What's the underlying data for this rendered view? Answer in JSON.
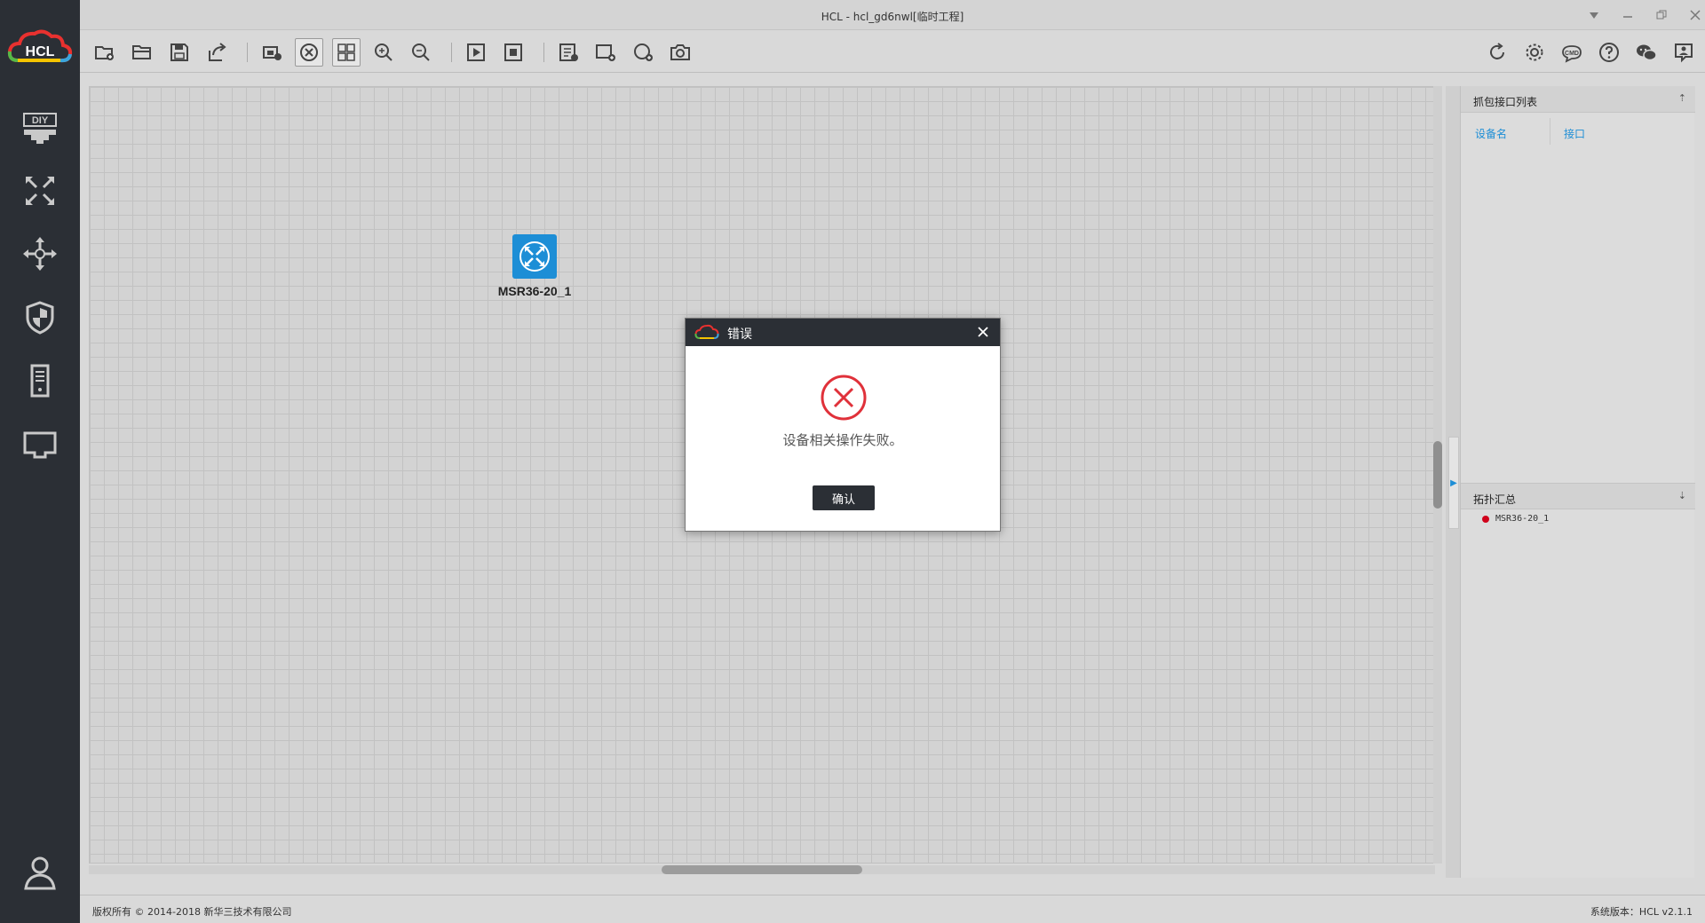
{
  "window": {
    "title": "HCL - hcl_gd6nwl[临时工程]",
    "controls": [
      "dropdown-icon",
      "minimize-icon",
      "restore-icon",
      "close-icon"
    ]
  },
  "sidebar": {
    "logo_text": "HCL",
    "items": [
      {
        "name": "diy",
        "icon": "diy-icon"
      },
      {
        "name": "router",
        "icon": "router-icon"
      },
      {
        "name": "switch",
        "icon": "switch-icon"
      },
      {
        "name": "firewall",
        "icon": "shield-icon"
      },
      {
        "name": "host",
        "icon": "server-icon"
      },
      {
        "name": "cable",
        "icon": "connector-icon"
      }
    ],
    "user_icon": "user-icon"
  },
  "toolbar": {
    "left_tools": [
      "new-project-icon",
      "open-project-icon",
      "save-icon",
      "export-icon",
      "import-device-icon",
      "topology-view-icon",
      "grid-view-icon",
      "zoom-in-icon",
      "zoom-out-icon",
      "start-all-icon",
      "stop-all-icon",
      "list-icon",
      "add-rect-icon",
      "add-ellipse-icon",
      "screenshot-icon"
    ],
    "right_tools": [
      "refresh-icon",
      "settings-icon",
      "cmd-icon",
      "help-icon",
      "wechat-icon",
      "feedback-icon"
    ],
    "cmd_label": "CMD"
  },
  "canvas": {
    "device": {
      "label": "MSR36-20_1",
      "icon": "router-icon",
      "color": "#1d8ed6"
    }
  },
  "right_panel": {
    "capture": {
      "title": "抓包接口列表",
      "col_device": "设备名",
      "col_port": "接口"
    },
    "topology": {
      "title": "拓扑汇总",
      "items": [
        {
          "label": "MSR36-20_1",
          "status_color": "#d0021b"
        }
      ]
    }
  },
  "status": {
    "copyright": "版权所有 © 2014-2018 新华三技术有限公司",
    "version": "系统版本：HCL v2.1.1"
  },
  "dialog": {
    "title": "错误",
    "message": "设备相关操作失败。",
    "ok_label": "确认",
    "icon": "error-icon",
    "accent": "#e0313a"
  }
}
